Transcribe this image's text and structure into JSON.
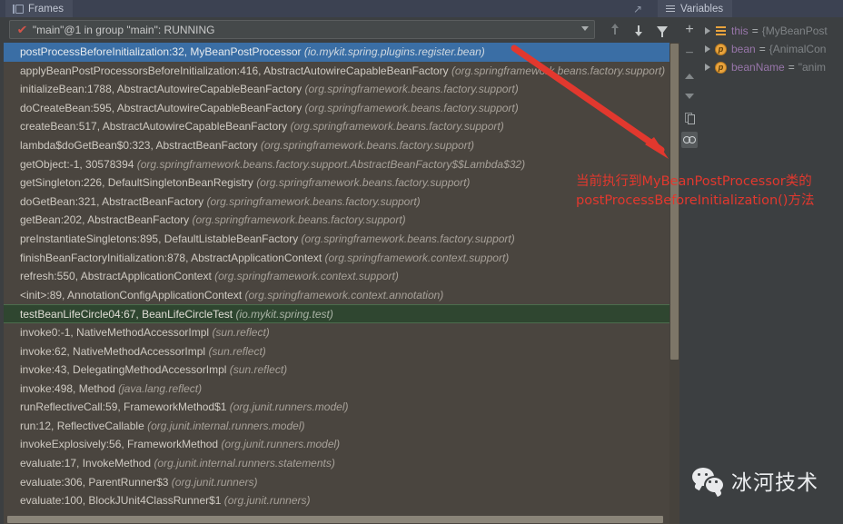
{
  "tabs": {
    "frames": {
      "label": "Frames",
      "icon": "frames-icon"
    },
    "variables": {
      "label": "Variables",
      "icon": "variables-icon"
    },
    "pin_icon": "pin-tab-icon"
  },
  "thread_selector": {
    "value": "\"main\"@1 in group \"main\": RUNNING",
    "status_icon": "running-check-icon",
    "dropdown_icon": "chevron-down-icon"
  },
  "frames_toolbar": [
    {
      "name": "move-frame-up-button",
      "icon": "arrow-up-icon",
      "enabled": false
    },
    {
      "name": "move-frame-down-button",
      "icon": "arrow-down-icon",
      "enabled": true
    },
    {
      "name": "filter-frames-button",
      "icon": "funnel-icon",
      "enabled": true
    }
  ],
  "variables_toolbar": [
    {
      "name": "add-watch-button",
      "icon": "plus-icon",
      "label": "+"
    },
    {
      "name": "remove-watch-button",
      "icon": "minus-icon",
      "label": "−"
    },
    {
      "name": "scroll-up-button",
      "icon": "triangle-up-icon"
    },
    {
      "name": "scroll-down-button",
      "icon": "triangle-down-icon"
    },
    {
      "name": "copy-value-button",
      "icon": "copy-icon"
    },
    {
      "name": "watches-toggle-button",
      "icon": "watches-icon"
    }
  ],
  "frames": [
    {
      "method": "postProcessBeforeInitialization:32, MyBeanPostProcessor",
      "package": "(io.mykit.spring.plugins.register.bean)",
      "state": "selected"
    },
    {
      "method": "applyBeanPostProcessorsBeforeInitialization:416, AbstractAutowireCapableBeanFactory",
      "package": "(org.springframework.beans.factory.support)",
      "state": "normal"
    },
    {
      "method": "initializeBean:1788, AbstractAutowireCapableBeanFactory",
      "package": "(org.springframework.beans.factory.support)",
      "state": "normal"
    },
    {
      "method": "doCreateBean:595, AbstractAutowireCapableBeanFactory",
      "package": "(org.springframework.beans.factory.support)",
      "state": "normal"
    },
    {
      "method": "createBean:517, AbstractAutowireCapableBeanFactory",
      "package": "(org.springframework.beans.factory.support)",
      "state": "normal"
    },
    {
      "method": "lambda$doGetBean$0:323, AbstractBeanFactory",
      "package": "(org.springframework.beans.factory.support)",
      "state": "normal"
    },
    {
      "method": "getObject:-1, 30578394",
      "package": "(org.springframework.beans.factory.support.AbstractBeanFactory$$Lambda$32)",
      "state": "normal"
    },
    {
      "method": "getSingleton:226, DefaultSingletonBeanRegistry",
      "package": "(org.springframework.beans.factory.support)",
      "state": "normal"
    },
    {
      "method": "doGetBean:321, AbstractBeanFactory",
      "package": "(org.springframework.beans.factory.support)",
      "state": "normal"
    },
    {
      "method": "getBean:202, AbstractBeanFactory",
      "package": "(org.springframework.beans.factory.support)",
      "state": "normal"
    },
    {
      "method": "preInstantiateSingletons:895, DefaultListableBeanFactory",
      "package": "(org.springframework.beans.factory.support)",
      "state": "normal"
    },
    {
      "method": "finishBeanFactoryInitialization:878, AbstractApplicationContext",
      "package": "(org.springframework.context.support)",
      "state": "normal"
    },
    {
      "method": "refresh:550, AbstractApplicationContext",
      "package": "(org.springframework.context.support)",
      "state": "normal"
    },
    {
      "method": "<init>:89, AnnotationConfigApplicationContext",
      "package": "(org.springframework.context.annotation)",
      "state": "normal"
    },
    {
      "method": "testBeanLifeCircle04:67, BeanLifeCircleTest",
      "package": "(io.mykit.spring.test)",
      "state": "highlight"
    },
    {
      "method": "invoke0:-1, NativeMethodAccessorImpl",
      "package": "(sun.reflect)",
      "state": "normal"
    },
    {
      "method": "invoke:62, NativeMethodAccessorImpl",
      "package": "(sun.reflect)",
      "state": "normal"
    },
    {
      "method": "invoke:43, DelegatingMethodAccessorImpl",
      "package": "(sun.reflect)",
      "state": "normal"
    },
    {
      "method": "invoke:498, Method",
      "package": "(java.lang.reflect)",
      "state": "normal"
    },
    {
      "method": "runReflectiveCall:59, FrameworkMethod$1",
      "package": "(org.junit.runners.model)",
      "state": "normal"
    },
    {
      "method": "run:12, ReflectiveCallable",
      "package": "(org.junit.internal.runners.model)",
      "state": "normal"
    },
    {
      "method": "invokeExplosively:56, FrameworkMethod",
      "package": "(org.junit.runners.model)",
      "state": "normal"
    },
    {
      "method": "evaluate:17, InvokeMethod",
      "package": "(org.junit.internal.runners.statements)",
      "state": "normal"
    },
    {
      "method": "evaluate:306, ParentRunner$3",
      "package": "(org.junit.runners)",
      "state": "normal"
    },
    {
      "method": "evaluate:100, BlockJUnit4ClassRunner$1",
      "package": "(org.junit.runners)",
      "state": "normal"
    }
  ],
  "variables": [
    {
      "icon": "this-object-icon",
      "name": "this",
      "eq": "=",
      "value": "{MyBeanPost"
    },
    {
      "icon": "parameter-icon",
      "name": "bean",
      "eq": "=",
      "value": "{AnimalCon"
    },
    {
      "icon": "parameter-icon",
      "name": "beanName",
      "eq": "=",
      "value": "\"anim"
    }
  ],
  "annotation": {
    "line1": "当前执行到MyBeanPostProcessor类的",
    "line2": "postProcessBeforeInitialization()方法",
    "color": "#e2382e",
    "arrow_icon": "red-arrow-icon"
  },
  "watermark": {
    "text": "冰河技术",
    "icon": "wechat-logo-icon"
  }
}
